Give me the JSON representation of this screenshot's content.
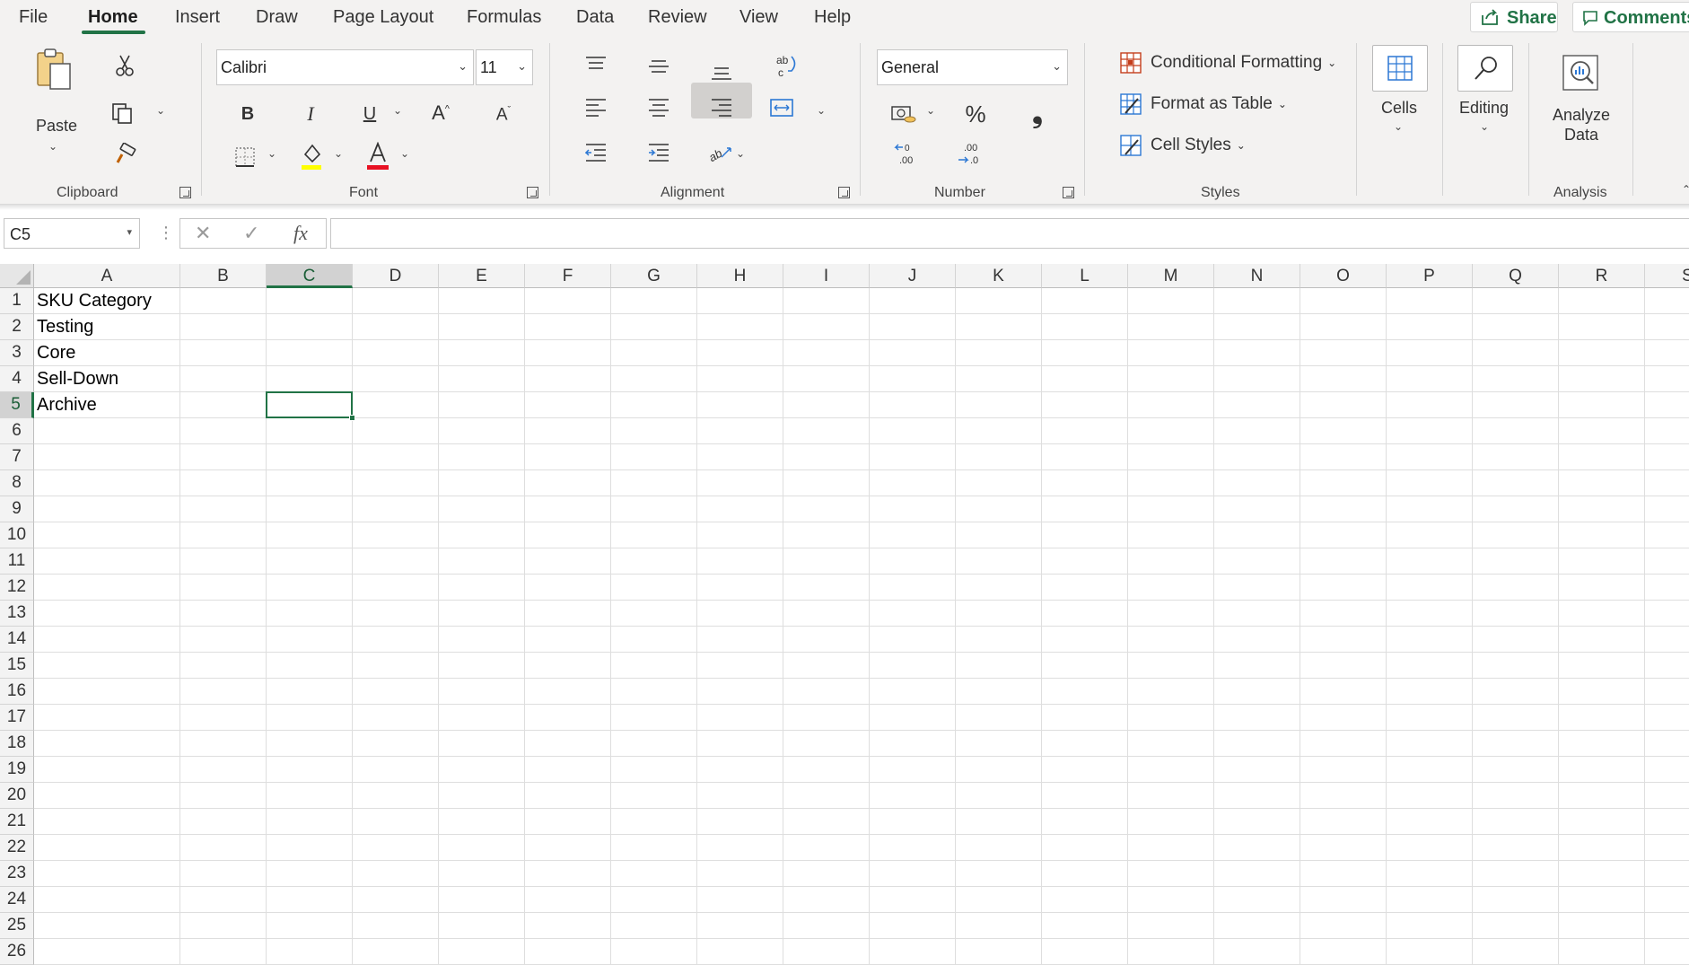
{
  "menu": {
    "tabs": [
      {
        "label": "File"
      },
      {
        "label": "Home"
      },
      {
        "label": "Insert"
      },
      {
        "label": "Draw"
      },
      {
        "label": "Page Layout"
      },
      {
        "label": "Formulas"
      },
      {
        "label": "Data"
      },
      {
        "label": "Review"
      },
      {
        "label": "View"
      },
      {
        "label": "Help"
      }
    ],
    "active_tab": "Home",
    "share_label": "Share",
    "comments_label": "Comments"
  },
  "ribbon": {
    "clipboard": {
      "paste_label": "Paste",
      "group_label": "Clipboard"
    },
    "font": {
      "font_name": "Calibri",
      "font_size": "11",
      "group_label": "Font",
      "bold": "B",
      "italic": "I",
      "underline": "U",
      "font_color": "#e81123",
      "highlight_color": "#ffff00"
    },
    "alignment": {
      "group_label": "Alignment"
    },
    "number": {
      "format": "General",
      "group_label": "Number",
      "percent": "%",
      "comma": "❟"
    },
    "styles": {
      "conditional_formatting": "Conditional Formatting",
      "format_as_table": "Format as Table",
      "cell_styles": "Cell Styles",
      "group_label": "Styles"
    },
    "cells": {
      "label": "Cells"
    },
    "editing": {
      "label": "Editing"
    },
    "analysis": {
      "analyze_line1": "Analyze",
      "analyze_line2": "Data",
      "group_label": "Analysis"
    }
  },
  "formula_bar": {
    "name_box": "C5",
    "fx": "fx",
    "formula": ""
  },
  "sheet": {
    "accent_color": "#217346",
    "columns": [
      "A",
      "B",
      "C",
      "D",
      "E",
      "F",
      "G",
      "H",
      "I",
      "J",
      "K",
      "L",
      "M",
      "N",
      "O",
      "P",
      "Q",
      "R",
      "S"
    ],
    "rows": [
      "1",
      "2",
      "3",
      "4",
      "5",
      "6",
      "7",
      "8",
      "9",
      "10",
      "11",
      "12",
      "13",
      "14",
      "15",
      "16",
      "17",
      "18",
      "19",
      "20",
      "21",
      "22",
      "23",
      "24",
      "25",
      "26"
    ],
    "cells": {
      "A1": "SKU Category",
      "A2": "Testing",
      "A3": "Core",
      "A4": "Sell-Down",
      "A5": "Archive"
    },
    "active_cell": "C5"
  }
}
